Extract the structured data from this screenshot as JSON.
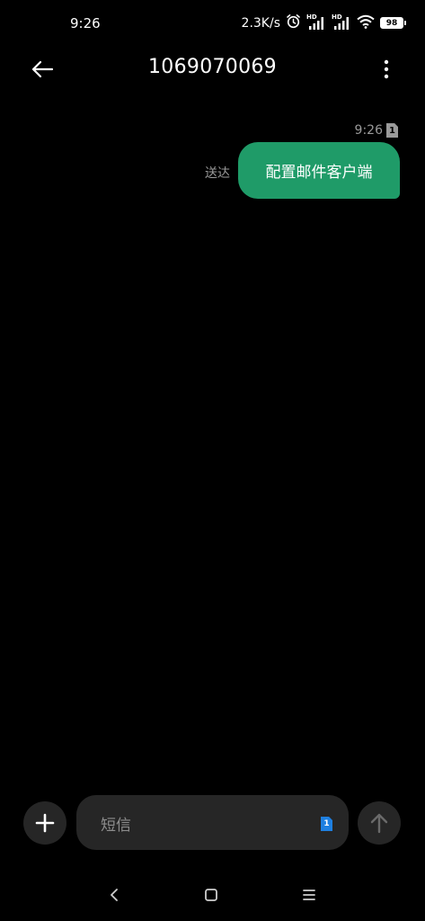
{
  "status_bar": {
    "time": "9:26",
    "net_speed": "2.3K/s",
    "signal1_label": "HD",
    "signal2_label": "HD",
    "battery": "98"
  },
  "header": {
    "title": "1069070069"
  },
  "messages": [
    {
      "time": "9:26",
      "sim": "1",
      "status": "送达",
      "text": "配置邮件客户端"
    }
  ],
  "composer": {
    "placeholder": "短信",
    "sim": "1"
  },
  "colors": {
    "background": "#000000",
    "bubble": "#1f9b68",
    "control_bg": "#262626",
    "sim_accent": "#1e7fe0"
  },
  "icons": {
    "back": "back-arrow-icon",
    "more": "more-vertical-icon",
    "add": "plus-icon",
    "send": "arrow-up-icon",
    "nav_back": "chevron-left-icon",
    "nav_home": "square-icon",
    "nav_menu": "menu-icon"
  }
}
